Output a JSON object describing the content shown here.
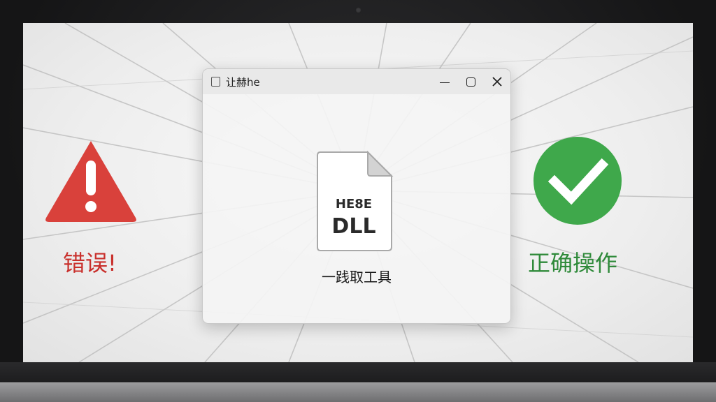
{
  "dialog": {
    "title": "让赫he",
    "controls": [
      "minimize",
      "maximize",
      "close"
    ],
    "file_icon": {
      "icon": "document-icon",
      "line1": "HE8E",
      "line2": "DLL"
    },
    "label": "一践取工具"
  },
  "error": {
    "icon": "warning-triangle-icon",
    "label": "错误!",
    "color": "#d9413b"
  },
  "success": {
    "icon": "checkmark-circle-icon",
    "label": "正确操作",
    "color": "#3fa84b"
  }
}
